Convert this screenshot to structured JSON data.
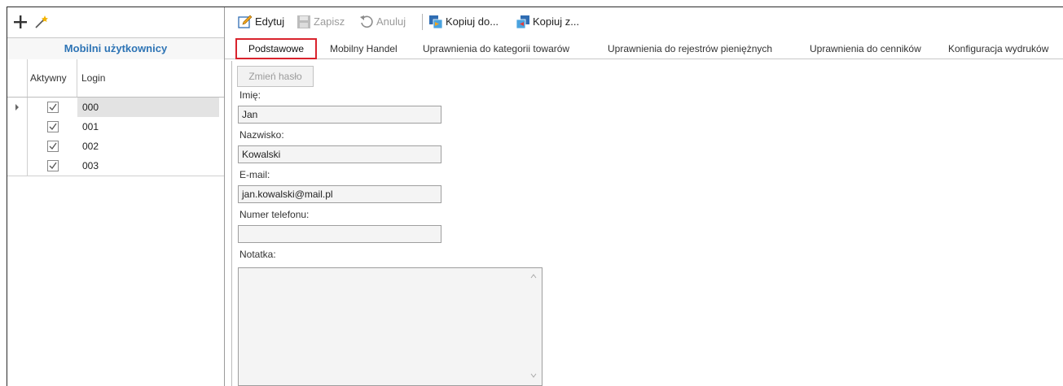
{
  "left_panel": {
    "title": "Mobilni użytkownicy",
    "icons": [
      "add-icon",
      "magic-wand-icon"
    ],
    "columns": {
      "active": "Aktywny",
      "login": "Login"
    },
    "rows": [
      {
        "login": "000",
        "active": true,
        "selected": true
      },
      {
        "login": "001",
        "active": true,
        "selected": false
      },
      {
        "login": "002",
        "active": true,
        "selected": false
      },
      {
        "login": "003",
        "active": true,
        "selected": false
      }
    ]
  },
  "toolbar": {
    "edit": "Edytuj",
    "save": "Zapisz",
    "cancel": "Anuluj",
    "copy_to": "Kopiuj do...",
    "copy_from": "Kopiuj z..."
  },
  "tabs": [
    "Podstawowe",
    "Mobilny Handel",
    "Uprawnienia do kategorii towarów",
    "Uprawnienia do rejestrów pieniężnych",
    "Uprawnienia do cenników",
    "Konfiguracja wydruków"
  ],
  "active_tab": "Podstawowe",
  "form": {
    "change_password": "Zmień hasło",
    "first_name_label": "Imię:",
    "first_name": "Jan",
    "last_name_label": "Nazwisko:",
    "last_name": "Kowalski",
    "email_label": "E-mail:",
    "email": "jan.kowalski@mail.pl",
    "phone_label": "Numer telefonu:",
    "phone": "",
    "notes_label": "Notatka:",
    "notes": ""
  },
  "colors": {
    "title_blue": "#2e74b5",
    "active_tab_border": "#d9232d"
  }
}
